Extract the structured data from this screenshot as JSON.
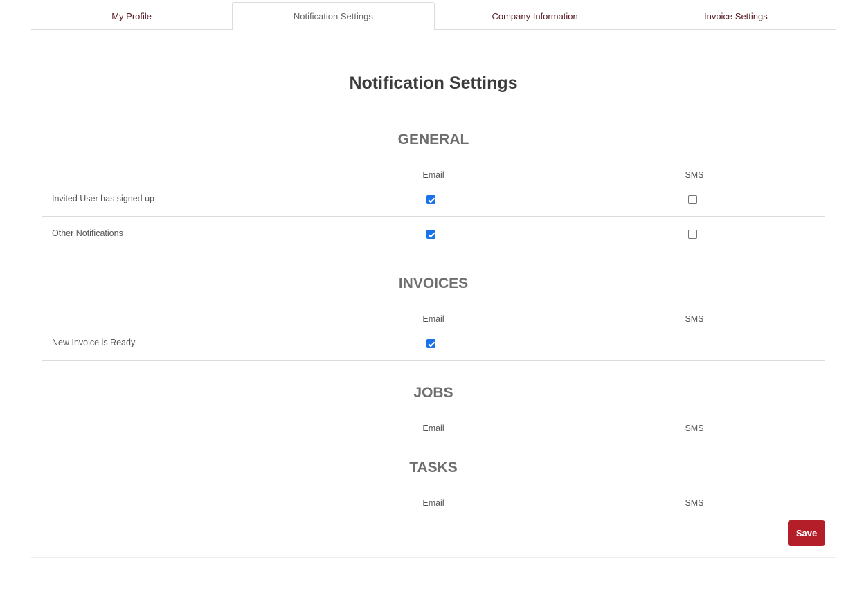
{
  "tabs": [
    {
      "label": "My Profile",
      "active": false
    },
    {
      "label": "Notification Settings",
      "active": true
    },
    {
      "label": "Company Information",
      "active": false
    },
    {
      "label": "Invoice Settings",
      "active": false
    }
  ],
  "page_title": "Notification Settings",
  "columns": {
    "email": "Email",
    "sms": "SMS"
  },
  "sections": [
    {
      "title": "GENERAL",
      "rows": [
        {
          "label": "Invited User has signed up",
          "email": true,
          "sms": false
        },
        {
          "label": "Other Notifications",
          "email": true,
          "sms": false
        }
      ]
    },
    {
      "title": "INVOICES",
      "rows": [
        {
          "label": "New Invoice is Ready",
          "email": true
        }
      ]
    },
    {
      "title": "JOBS",
      "rows": []
    },
    {
      "title": "TASKS",
      "rows": []
    }
  ],
  "save_label": "Save",
  "colors": {
    "accent": "#b31e28",
    "checkbox": "#1a73e8",
    "tab_text": "#5a1a22"
  }
}
